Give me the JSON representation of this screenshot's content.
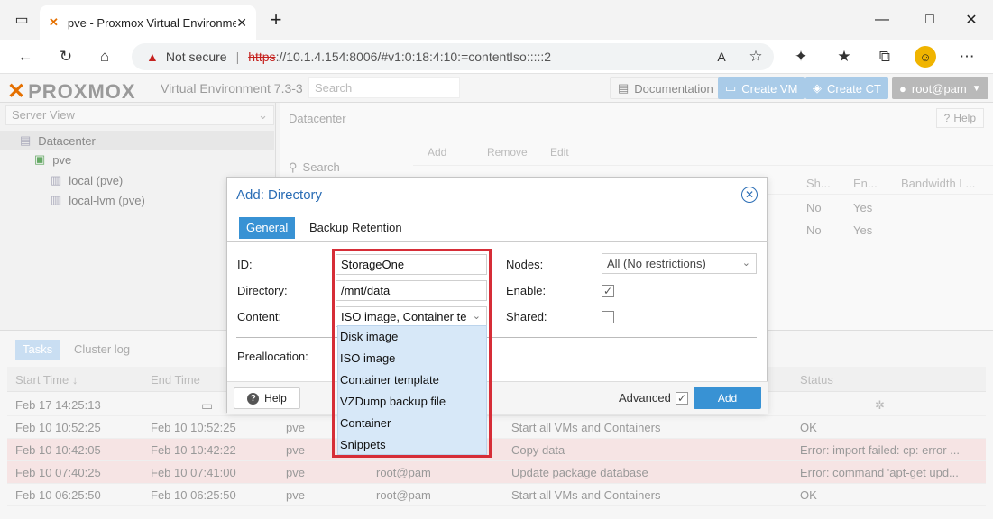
{
  "browser": {
    "tab_title": "pve - Proxmox Virtual Environme",
    "url_warning": "Not secure",
    "url_scheme": "https",
    "url_rest": "://10.1.4.154:8006/#v1:0:18:4:10:=contentIso:::::2"
  },
  "pve_header": {
    "logo_text": "PROXMOX",
    "logo_x": "✕",
    "version": "Virtual Environment 7.3-3",
    "search_placeholder": "Search",
    "documentation": "Documentation",
    "create_vm": "Create VM",
    "create_ct": "Create CT",
    "user": "root@pam"
  },
  "tree": {
    "view": "Server View",
    "nodes": [
      "Datacenter",
      "pve",
      "local (pve)",
      "local-lvm (pve)"
    ]
  },
  "datacenter": {
    "title": "Datacenter",
    "help": "Help",
    "search": "Search",
    "toolbar": [
      "Add",
      "Remove",
      "Edit"
    ],
    "columns": [
      "Sh...",
      "En...",
      "Bandwidth L..."
    ],
    "rows": [
      [
        "No",
        "Yes"
      ],
      [
        "No",
        "Yes"
      ]
    ]
  },
  "tasks": {
    "tabs": [
      "Tasks",
      "Cluster log"
    ],
    "columns": [
      "Start Time ↓",
      "End Time",
      "Status"
    ],
    "rows": [
      {
        "start": "Feb 17 14:25:13",
        "end": "",
        "node": "",
        "user": "",
        "desc": "",
        "status": ""
      },
      {
        "start": "Feb 10 10:52:25",
        "end": "Feb 10 10:52:25",
        "node": "pve",
        "user": "",
        "desc": "Start all VMs and Containers",
        "status": "OK"
      },
      {
        "start": "Feb 10 10:42:05",
        "end": "Feb 10 10:42:22",
        "node": "pve",
        "user": "",
        "desc": "Copy data",
        "status": "Error: import failed: cp: error ..."
      },
      {
        "start": "Feb 10 07:40:25",
        "end": "Feb 10 07:41:00",
        "node": "pve",
        "user": "root@pam",
        "desc": "Update package database",
        "status": "Error: command 'apt-get upd..."
      },
      {
        "start": "Feb 10 06:25:50",
        "end": "Feb 10 06:25:50",
        "node": "pve",
        "user": "root@pam",
        "desc": "Start all VMs and Containers",
        "status": "OK"
      }
    ]
  },
  "dialog": {
    "title": "Add: Directory",
    "tabs": [
      "General",
      "Backup Retention"
    ],
    "id_label": "ID:",
    "id_value": "StorageOne",
    "directory_label": "Directory:",
    "directory_value": "/mnt/data",
    "content_label": "Content:",
    "content_value": "ISO image, Container te",
    "nodes_label": "Nodes:",
    "nodes_value": "All (No restrictions)",
    "enable_label": "Enable:",
    "enable_checked": true,
    "shared_label": "Shared:",
    "shared_checked": false,
    "preallocation_label": "Preallocation:",
    "help_button": "Help",
    "advanced_label": "Advanced",
    "advanced_checked": true,
    "add_button": "Add"
  },
  "content_options": [
    "Disk image",
    "ISO image",
    "Container template",
    "VZDump backup file",
    "Container",
    "Snippets"
  ],
  "colors": {
    "accent": "#3892d4",
    "highlight_border": "#d62d37",
    "dropdown_bg": "#d7e8f8"
  }
}
